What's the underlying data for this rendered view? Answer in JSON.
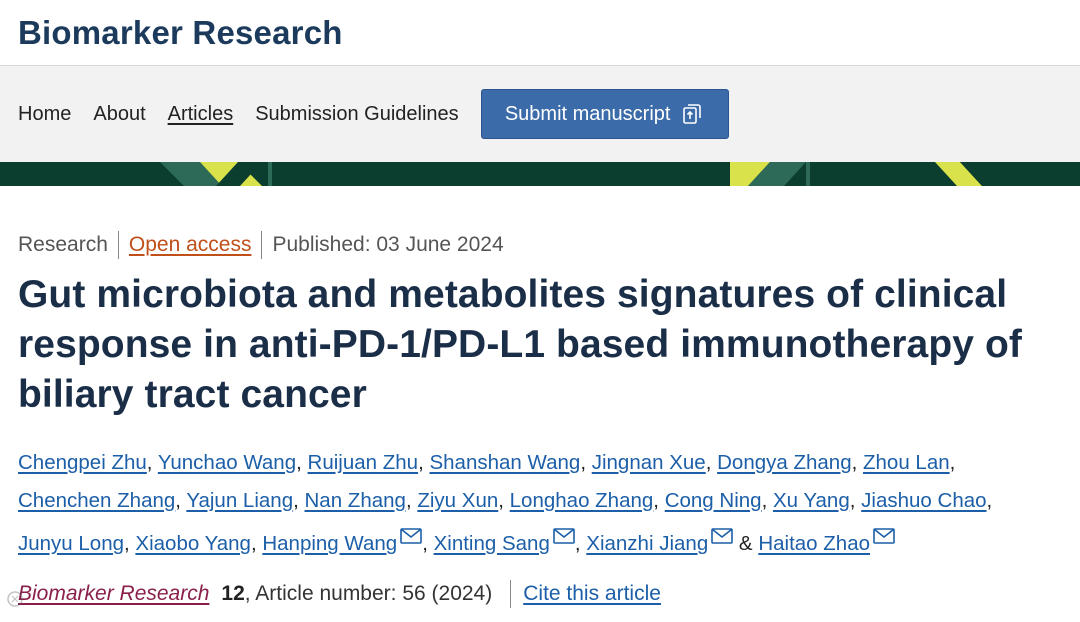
{
  "header": {
    "journal_title": "Biomarker Research"
  },
  "nav": {
    "items": [
      {
        "label": "Home",
        "active": false
      },
      {
        "label": "About",
        "active": false
      },
      {
        "label": "Articles",
        "active": true
      },
      {
        "label": "Submission Guidelines",
        "active": false
      }
    ],
    "submit_label": "Submit manuscript",
    "submit_icon": "external-submit-icon",
    "submit_color": "#3b6ba8"
  },
  "banner": {
    "colors": [
      "#0b3e2e",
      "#d9e24a",
      "#2e6a58"
    ]
  },
  "article": {
    "type": "Research",
    "access": "Open access",
    "published": "Published: 03 June 2024",
    "title": "Gut microbiota and metabolites signatures of clinical response in anti-PD-1/PD-L1 based immunotherapy of biliary tract cancer",
    "authors": [
      {
        "name": "Chengpei Zhu",
        "mail": false
      },
      {
        "name": "Yunchao Wang",
        "mail": false
      },
      {
        "name": "Ruijuan Zhu",
        "mail": false
      },
      {
        "name": "Shanshan Wang",
        "mail": false
      },
      {
        "name": "Jingnan Xue",
        "mail": false
      },
      {
        "name": "Dongya Zhang",
        "mail": false
      },
      {
        "name": "Zhou Lan",
        "mail": false
      },
      {
        "name": "Chenchen Zhang",
        "mail": false
      },
      {
        "name": "Yajun Liang",
        "mail": false
      },
      {
        "name": "Nan Zhang",
        "mail": false
      },
      {
        "name": "Ziyu Xun",
        "mail": false
      },
      {
        "name": "Longhao Zhang",
        "mail": false
      },
      {
        "name": "Cong Ning",
        "mail": false
      },
      {
        "name": "Xu Yang",
        "mail": false
      },
      {
        "name": "Jiashuo Chao",
        "mail": false
      },
      {
        "name": "Junyu Long",
        "mail": false
      },
      {
        "name": "Xiaobo Yang",
        "mail": false
      },
      {
        "name": "Hanping Wang",
        "mail": true
      },
      {
        "name": "Xinting Sang",
        "mail": true
      },
      {
        "name": "Xianzhi Jiang",
        "mail": true
      },
      {
        "name": "Haitao Zhao",
        "mail": true
      }
    ],
    "citation": {
      "journal": "Biomarker Research",
      "volume": "12",
      "article_number": ", Article number: 56 (2024)",
      "cite_label": "Cite this article"
    }
  },
  "colors": {
    "title": "#1b2e48",
    "link": "#1c5fa8",
    "open_access": "#c0501a",
    "journal_link": "#8a1f4b"
  }
}
